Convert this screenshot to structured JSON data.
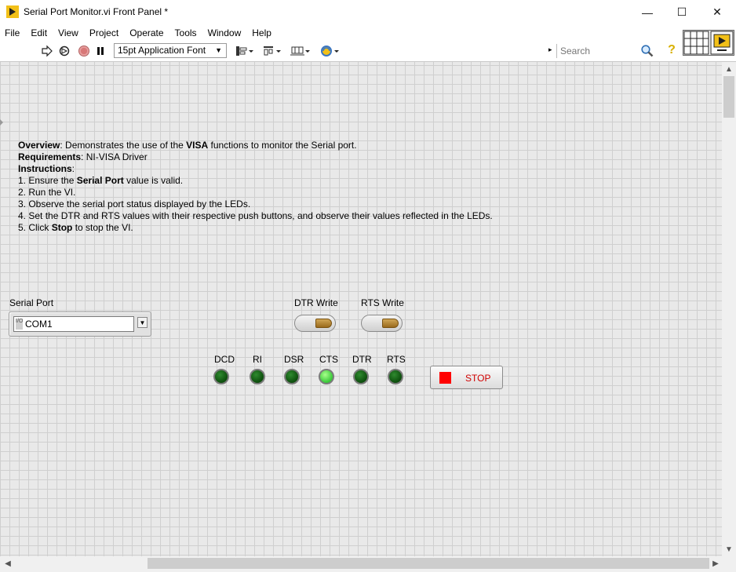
{
  "window": {
    "title": "Serial Port Monitor.vi Front Panel *",
    "minimize": "—",
    "maximize": "☐",
    "close": "✕"
  },
  "menu": [
    "File",
    "Edit",
    "View",
    "Project",
    "Operate",
    "Tools",
    "Window",
    "Help"
  ],
  "toolbar": {
    "font": "15pt Application Font",
    "search_placeholder": "Search",
    "search_marker": "▸",
    "help_glyph": "?"
  },
  "description": {
    "overview_label": "Overview",
    "overview_text_1": ": Demonstrates the use of the ",
    "overview_bold": "VISA",
    "overview_text_2": " functions to monitor the Serial port.",
    "requirements_label": "Requirements",
    "requirements_text": ": NI-VISA Driver",
    "instructions_label": "Instructions",
    "instructions_colon": ":",
    "step1_a": "1. Ensure the ",
    "step1_bold": "Serial Port",
    "step1_b": " value is valid.",
    "step2": "2. Run the VI.",
    "step3": "3. Observe the serial port status displayed by the LEDs.",
    "step4": "4. Set the DTR and RTS values with their respective push buttons, and observe their values reflected in the LEDs.",
    "step5_a": "5. Click ",
    "step5_bold": "Stop",
    "step5_b": " to stop the VI."
  },
  "serial_port": {
    "label": "Serial Port",
    "value": "COM1",
    "tag": "I/O"
  },
  "buttons": {
    "dtr_write": "DTR Write",
    "rts_write": "RTS Write",
    "stop": "STOP"
  },
  "leds": [
    {
      "label": "DCD",
      "on": false
    },
    {
      "label": "RI",
      "on": false
    },
    {
      "label": "DSR",
      "on": false
    },
    {
      "label": "CTS",
      "on": true
    },
    {
      "label": "DTR",
      "on": false
    },
    {
      "label": "RTS",
      "on": false
    }
  ],
  "colors": {
    "led_on": "#38c838",
    "led_off": "#0c4d0c",
    "stop_red": "#ff0000",
    "canvas_bg": "#e9e9e9"
  }
}
